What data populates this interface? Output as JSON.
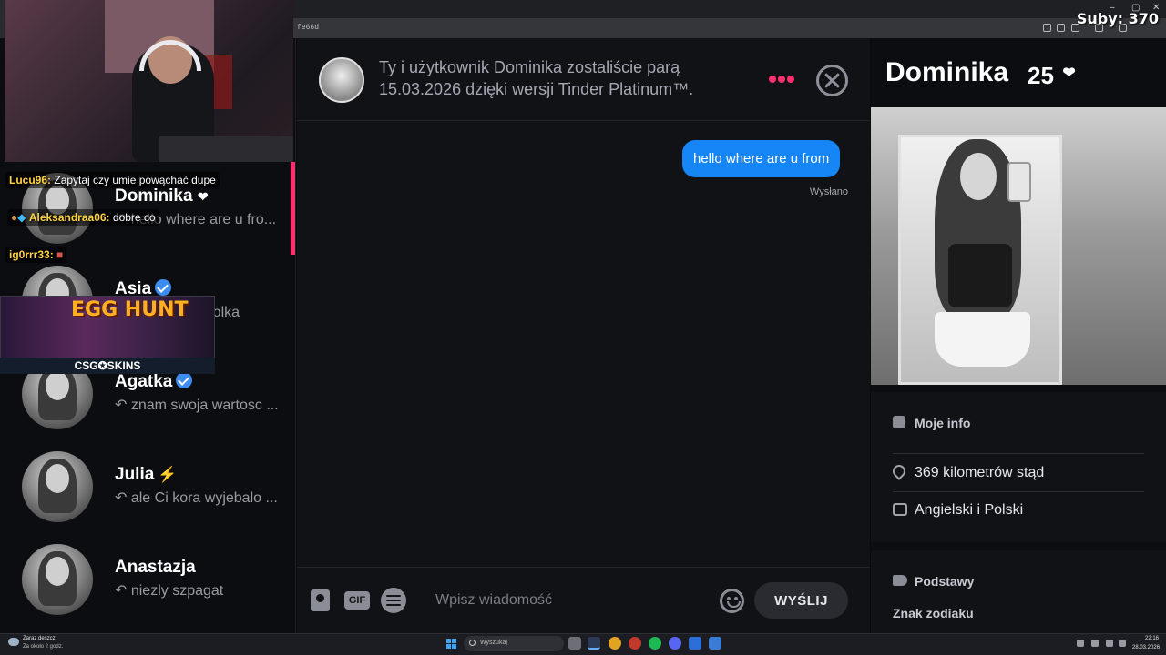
{
  "stream": {
    "subs_label": "Suby: 370",
    "chat": [
      {
        "user": "Lucu96:",
        "user_color": "#ffd23f",
        "text": "Zapytaj czy umie powąchać dupe"
      },
      {
        "user": "Aleksandraa06:",
        "user_color": "#ffd23f",
        "text": "dobre co"
      },
      {
        "user": "ig0rrr33:",
        "user_color": "#ffd23f",
        "text": ""
      }
    ],
    "sponsor": {
      "title": "EGG HUNT",
      "label": "CSG✪SKINS"
    }
  },
  "browser": {
    "url_fragment": "fe66d",
    "window_controls": [
      "–",
      "▢",
      "✕"
    ]
  },
  "matches": [
    {
      "name": "Dominika",
      "preview": "↶ hello where are u fro...",
      "badge": "heart",
      "active": true
    },
    {
      "name": "Asia",
      "preview": "↶ Polska czy polka",
      "badge": "verified",
      "active": false
    },
    {
      "name": "Agatka",
      "preview": "↶ znam swoja wartosc ...",
      "badge": "verified",
      "active": false
    },
    {
      "name": "Julia",
      "preview": "↶ ale Ci kora wyjebalo ...",
      "badge": "bolt",
      "active": false
    },
    {
      "name": "Anastazja",
      "preview": "↶ niezly szpagat",
      "badge": "",
      "active": false
    }
  ],
  "conversation": {
    "match_notice": "Ty i użytkownik Dominika zostaliście parą 15.03.2026 dzięki wersji Tinder Platinum™.",
    "messages": [
      {
        "text": "hello where are u from",
        "status": "Wysłano",
        "from_me": true
      }
    ],
    "composer": {
      "placeholder": "Wpisz wiadomość",
      "gif_label": "GIF",
      "send_label": "WYŚLIJ"
    },
    "accent_color": "#fd2f6f",
    "bubble_color": "#1685f5"
  },
  "profile": {
    "name": "Dominika",
    "age": "25",
    "info_title": "Moje info",
    "distance": "369 kilometrów stąd",
    "languages": "Angielski i Polski",
    "basics_title": "Podstawy",
    "zodiac_label": "Znak zodiaku"
  },
  "taskbar": {
    "weather_line1": "Zaraz deszcz",
    "weather_line2": "Za około 2 godz.",
    "search_placeholder": "Wyszukaj",
    "time": "22:16",
    "date": "28.03.2026"
  }
}
